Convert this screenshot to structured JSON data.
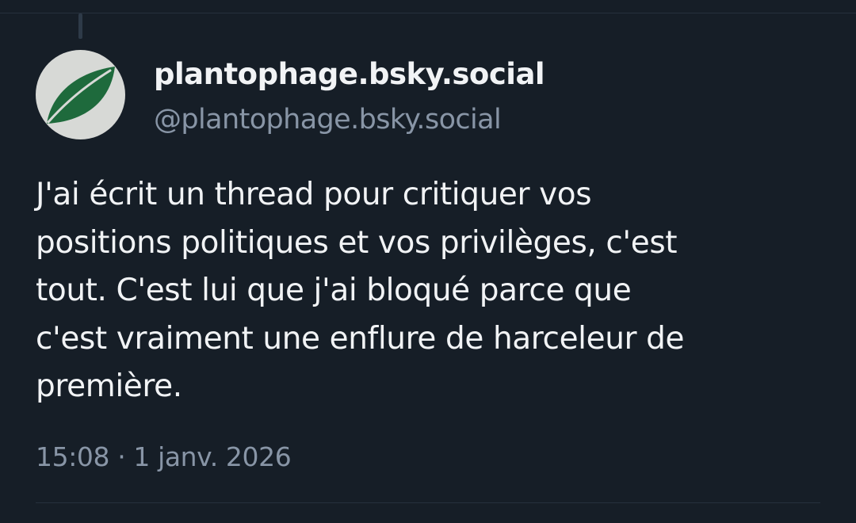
{
  "post": {
    "display_name": "plantophage.bsky.social",
    "handle": "@plantophage.bsky.social",
    "text": "J'ai écrit un thread pour critiquer vos\npositions politiques et vos privilèges, c'est\ntout. C'est lui que j'ai bloqué parce que\nc'est vraiment une enflure de harceleur de\npremière.",
    "time": "15:08",
    "separator": " · ",
    "date": "1 janv. 2026"
  },
  "avatar": {
    "icon": "leaf-icon",
    "background_color": "#d7d9d6",
    "leaf_color": "#1e6a3c"
  },
  "colors": {
    "background": "#161e27",
    "primary_text": "#f1f3f5",
    "secondary_text": "#8895a6",
    "divider": "#26303c"
  }
}
